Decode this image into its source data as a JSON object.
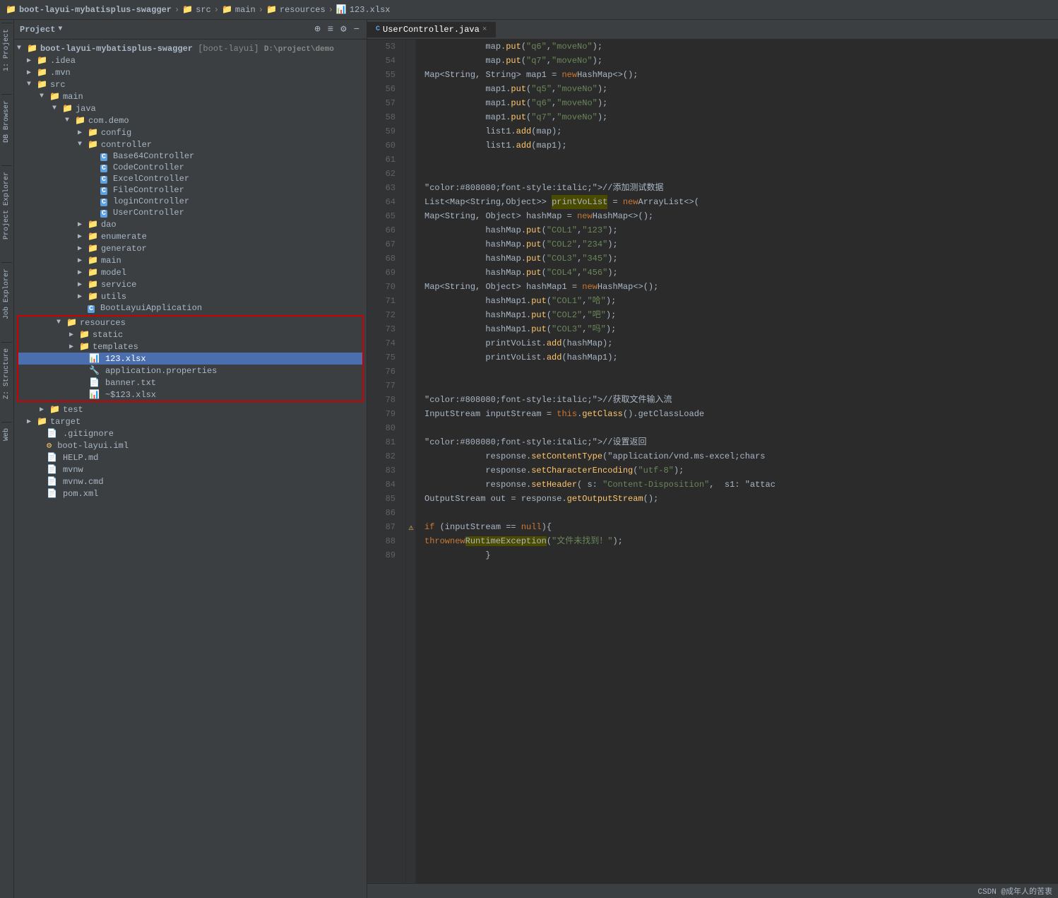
{
  "breadcrumb": {
    "items": [
      "boot-layui-mybatisplus-swagger",
      "src",
      "main",
      "resources",
      "123.xlsx"
    ]
  },
  "panel": {
    "title": "Project",
    "dropdown_icon": "▼"
  },
  "file_tree": {
    "root": "boot-layui-mybatisplus-swagger [boot-layui]",
    "root_path": "D:\\project\\demo",
    "items": [
      {
        "id": "idea",
        "label": ".idea",
        "type": "folder",
        "depth": 1,
        "expanded": false
      },
      {
        "id": "mvn",
        "label": ".mvn",
        "type": "folder",
        "depth": 1,
        "expanded": false
      },
      {
        "id": "src",
        "label": "src",
        "type": "folder",
        "depth": 1,
        "expanded": true
      },
      {
        "id": "main",
        "label": "main",
        "type": "folder",
        "depth": 2,
        "expanded": true
      },
      {
        "id": "java",
        "label": "java",
        "type": "folder",
        "depth": 3,
        "expanded": true
      },
      {
        "id": "com_demo",
        "label": "com.demo",
        "type": "folder",
        "depth": 4,
        "expanded": true
      },
      {
        "id": "config",
        "label": "config",
        "type": "folder",
        "depth": 5,
        "expanded": false
      },
      {
        "id": "controller",
        "label": "controller",
        "type": "folder",
        "depth": 5,
        "expanded": true
      },
      {
        "id": "Base64Controller",
        "label": "Base64Controller",
        "type": "class",
        "depth": 6
      },
      {
        "id": "CodeController",
        "label": "CodeController",
        "type": "class",
        "depth": 6
      },
      {
        "id": "ExcelController",
        "label": "ExcelController",
        "type": "class",
        "depth": 6
      },
      {
        "id": "FileController",
        "label": "FileController",
        "type": "class",
        "depth": 6
      },
      {
        "id": "loginController",
        "label": "loginController",
        "type": "class",
        "depth": 6
      },
      {
        "id": "UserController",
        "label": "UserController",
        "type": "class",
        "depth": 6
      },
      {
        "id": "dao",
        "label": "dao",
        "type": "folder",
        "depth": 5,
        "expanded": false
      },
      {
        "id": "enumerate",
        "label": "enumerate",
        "type": "folder",
        "depth": 5,
        "expanded": false
      },
      {
        "id": "generator",
        "label": "generator",
        "type": "folder",
        "depth": 5,
        "expanded": false
      },
      {
        "id": "main_pkg",
        "label": "main",
        "type": "folder",
        "depth": 5,
        "expanded": false
      },
      {
        "id": "model",
        "label": "model",
        "type": "folder",
        "depth": 5,
        "expanded": false
      },
      {
        "id": "service",
        "label": "service",
        "type": "folder",
        "depth": 5,
        "expanded": false
      },
      {
        "id": "utils",
        "label": "utils",
        "type": "folder",
        "depth": 5,
        "expanded": false
      },
      {
        "id": "BootLayuiApplication",
        "label": "BootLayuiApplication",
        "type": "class",
        "depth": 5
      },
      {
        "id": "resources",
        "label": "resources",
        "type": "folder",
        "depth": 3,
        "expanded": true,
        "highlighted": true
      },
      {
        "id": "static",
        "label": "static",
        "type": "folder",
        "depth": 4,
        "expanded": false,
        "highlighted": true
      },
      {
        "id": "templates",
        "label": "templates",
        "type": "folder",
        "depth": 4,
        "expanded": false,
        "highlighted": true
      },
      {
        "id": "xlsx123",
        "label": "123.xlsx",
        "type": "xlsx",
        "depth": 4,
        "selected": true,
        "highlighted": true
      },
      {
        "id": "app_props",
        "label": "application.properties",
        "type": "properties",
        "depth": 4,
        "highlighted": true
      },
      {
        "id": "banner",
        "label": "banner.txt",
        "type": "txt",
        "depth": 4,
        "highlighted": true
      },
      {
        "id": "xlsx123shadow",
        "label": "~$123.xlsx",
        "type": "xlsx",
        "depth": 4,
        "highlighted": true
      },
      {
        "id": "test",
        "label": "test",
        "type": "folder",
        "depth": 2,
        "expanded": false
      },
      {
        "id": "target",
        "label": "target",
        "type": "folder",
        "depth": 1,
        "expanded": false
      },
      {
        "id": "gitignore",
        "label": ".gitignore",
        "type": "file",
        "depth": 1
      },
      {
        "id": "boot_iml",
        "label": "boot-layui.iml",
        "type": "iml",
        "depth": 1
      },
      {
        "id": "help_md",
        "label": "HELP.md",
        "type": "md",
        "depth": 1
      },
      {
        "id": "mvnw",
        "label": "mvnw",
        "type": "file",
        "depth": 1
      },
      {
        "id": "mvnw_cmd",
        "label": "mvnw.cmd",
        "type": "file",
        "depth": 1
      },
      {
        "id": "pom_xml",
        "label": "pom.xml",
        "type": "xml",
        "depth": 1
      }
    ]
  },
  "code_tab": {
    "filename": "UserController.java",
    "close_label": "×"
  },
  "code_lines": [
    {
      "num": 53,
      "content": "            map.put(\"q6\",\"moveNo\");"
    },
    {
      "num": 54,
      "content": "            map.put(\"q7\",\"moveNo\");"
    },
    {
      "num": 55,
      "content": "            Map<String, String> map1 = new HashMap<>();"
    },
    {
      "num": 56,
      "content": "            map1.put(\"q5\",\"moveNo\");"
    },
    {
      "num": 57,
      "content": "            map1.put(\"q6\",\"moveNo\");"
    },
    {
      "num": 58,
      "content": "            map1.put(\"q7\",\"moveNo\");"
    },
    {
      "num": 59,
      "content": "            list1.add(map);"
    },
    {
      "num": 60,
      "content": "            list1.add(map1);"
    },
    {
      "num": 61,
      "content": ""
    },
    {
      "num": 62,
      "content": ""
    },
    {
      "num": 63,
      "content": "            //添加测试数据"
    },
    {
      "num": 64,
      "content": "            List<Map<String,Object>> printVoList = new ArrayList<>(",
      "highlight_word": "printVoList"
    },
    {
      "num": 65,
      "content": "            Map<String, Object> hashMap = new HashMap<>();"
    },
    {
      "num": 66,
      "content": "            hashMap.put(\"COL1\",\"123\");"
    },
    {
      "num": 67,
      "content": "            hashMap.put(\"COL2\",\"234\");"
    },
    {
      "num": 68,
      "content": "            hashMap.put(\"COL3\",\"345\");"
    },
    {
      "num": 69,
      "content": "            hashMap.put(\"COL4\",\"456\");"
    },
    {
      "num": 70,
      "content": "            Map<String, Object> hashMap1 = new HashMap<>();"
    },
    {
      "num": 71,
      "content": "            hashMap1.put(\"COL1\",\"哈\");"
    },
    {
      "num": 72,
      "content": "            hashMap1.put(\"COL2\",\"吧\");"
    },
    {
      "num": 73,
      "content": "            hashMap1.put(\"COL3\",\"吗\");"
    },
    {
      "num": 74,
      "content": "            printVoList.add(hashMap);"
    },
    {
      "num": 75,
      "content": "            printVoList.add(hashMap1);"
    },
    {
      "num": 76,
      "content": ""
    },
    {
      "num": 77,
      "content": ""
    },
    {
      "num": 78,
      "content": "            //获取文件输入流"
    },
    {
      "num": 79,
      "content": "            InputStream inputStream = this.getClass().getClassLoade"
    },
    {
      "num": 80,
      "content": ""
    },
    {
      "num": 81,
      "content": "            //设置返回"
    },
    {
      "num": 82,
      "content": "            response.setContentType(\"application/vnd.ms-excel;chars"
    },
    {
      "num": 83,
      "content": "            response.setCharacterEncoding(\"utf-8\");"
    },
    {
      "num": 84,
      "content": "            response.setHeader( s: \"Content-Disposition\",  s1: \"attac"
    },
    {
      "num": 85,
      "content": "            OutputStream out = response.getOutputStream();"
    },
    {
      "num": 86,
      "content": ""
    },
    {
      "num": 87,
      "content": "            if (inputStream == null){"
    },
    {
      "num": 88,
      "content": "                throw new RuntimeException(\"文件未找到！\");",
      "highlight_word": "RuntimeException"
    },
    {
      "num": 89,
      "content": "            }"
    }
  ],
  "side_labels": {
    "project_explorer": "Project Explorer",
    "db_browser": "DB Browser",
    "job_explorer": "Job Explorer",
    "structure": "Z: Structure",
    "web": "Web"
  },
  "right_labels": {
    "project": "1: Project"
  },
  "bottom": {
    "credit": "CSDN @成年人的苦衷"
  }
}
